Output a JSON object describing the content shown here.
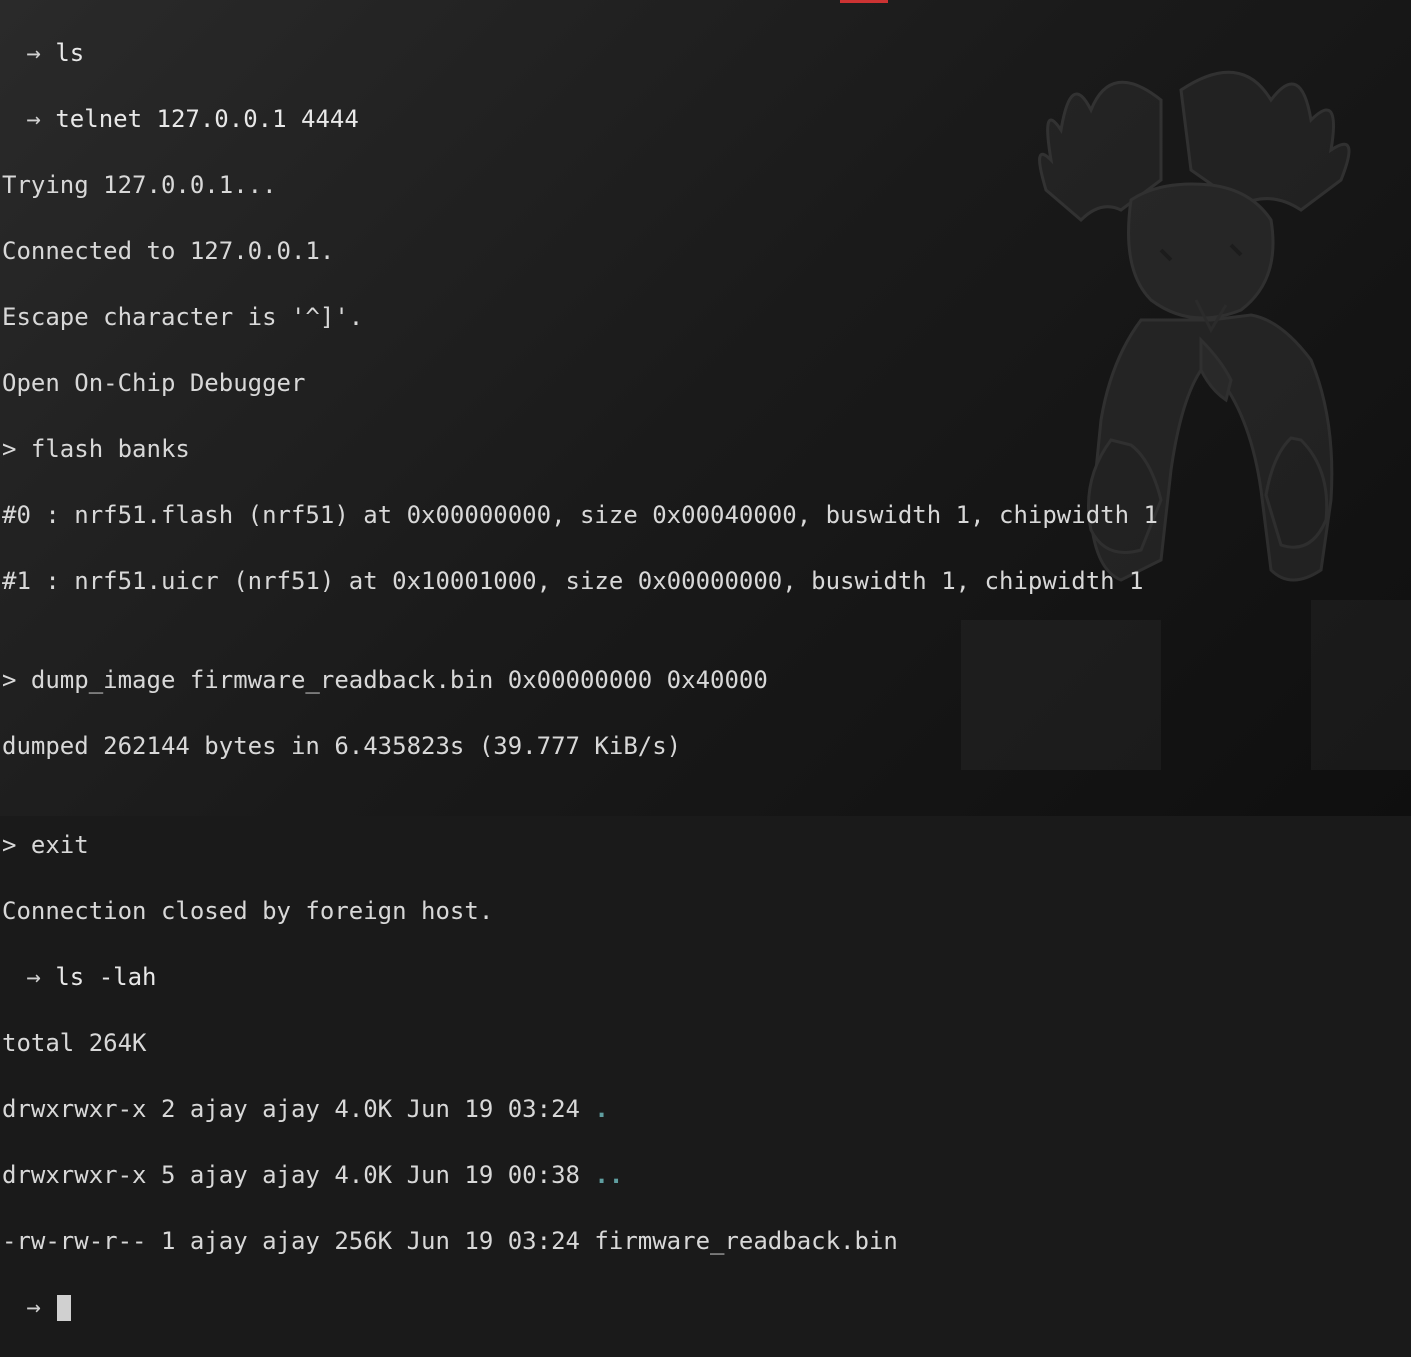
{
  "prompt": {
    "arrow": " → "
  },
  "lines": {
    "l0_cmd": "ls",
    "l1_cmd": "telnet 127.0.0.1 4444",
    "l2": "Trying 127.0.0.1...",
    "l3": "Connected to 127.0.0.1.",
    "l4": "Escape character is '^]'.",
    "l5": "Open On-Chip Debugger",
    "l6": "> flash banks",
    "l7": "#0 : nrf51.flash (nrf51) at 0x00000000, size 0x00040000, buswidth 1, chipwidth 1",
    "l8": "#1 : nrf51.uicr (nrf51) at 0x10001000, size 0x00000000, buswidth 1, chipwidth 1",
    "l9": "",
    "l10": "> dump_image firmware_readback.bin 0x00000000 0x40000",
    "l11": "dumped 262144 bytes in 6.435823s (39.777 KiB/s)",
    "l12": "",
    "l13": "> exit",
    "l14": "Connection closed by foreign host.",
    "l15_cmd": "ls -lah",
    "l16": "total 264K",
    "l17_pre": "drwxrwxr-x 2 ajay ajay 4.0K Jun 19 03:24 ",
    "l17_dot": ".",
    "l18_pre": "drwxrwxr-x 5 ajay ajay 4.0K Jun 19 00:38 ",
    "l18_dot": "..",
    "l19": "-rw-rw-r-- 1 ajay ajay 256K Jun 19 03:24 firmware_readback.bin"
  }
}
